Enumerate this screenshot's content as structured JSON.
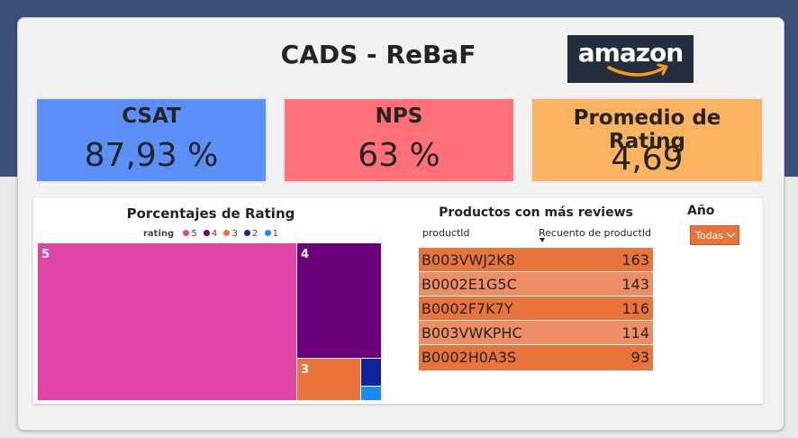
{
  "header": {
    "title": "CADS - ReBaF",
    "logo_text": "amazon"
  },
  "kpis": {
    "csat": {
      "label": "CSAT",
      "value": "87,93 %"
    },
    "nps": {
      "label": "NPS",
      "value": "63 %"
    },
    "rating": {
      "label": "Promedio de Rating",
      "value": "4,69"
    }
  },
  "colors": {
    "csat": "#5b8ff9",
    "nps": "#ff7078",
    "rating_card": "#fbb35f",
    "r5": "#e044a7",
    "r4": "#6b007b",
    "r3": "#e8743b",
    "r2": "#12239e",
    "r1": "#118dff",
    "row_dark": "#e8743b",
    "row_light": "#ee8e65"
  },
  "treemap": {
    "title": "Porcentajes de Rating",
    "legend_title": "rating",
    "chart_data": {
      "type": "treemap",
      "title": "Porcentajes de Rating",
      "legend": [
        "5",
        "4",
        "3",
        "2",
        "1"
      ],
      "categories": [
        "5",
        "4",
        "3",
        "2",
        "1"
      ],
      "values": [
        76,
        17,
        5,
        1.3,
        0.7
      ],
      "labels_shown": [
        "5",
        "4",
        "3"
      ]
    }
  },
  "products_table": {
    "title": "Productos con más reviews",
    "columns": [
      "productId",
      "Recuento de productId"
    ],
    "rows": [
      {
        "id": "B003VWJ2K8",
        "count": "163"
      },
      {
        "id": "B0002E1G5C",
        "count": "143"
      },
      {
        "id": "B0002F7K7Y",
        "count": "116"
      },
      {
        "id": "B003VWKPHC",
        "count": "114"
      },
      {
        "id": "B0002H0A3S",
        "count": "93"
      }
    ]
  },
  "year_slicer": {
    "title": "Año",
    "selected": "Todas",
    "icon": "chevron-down-icon"
  }
}
